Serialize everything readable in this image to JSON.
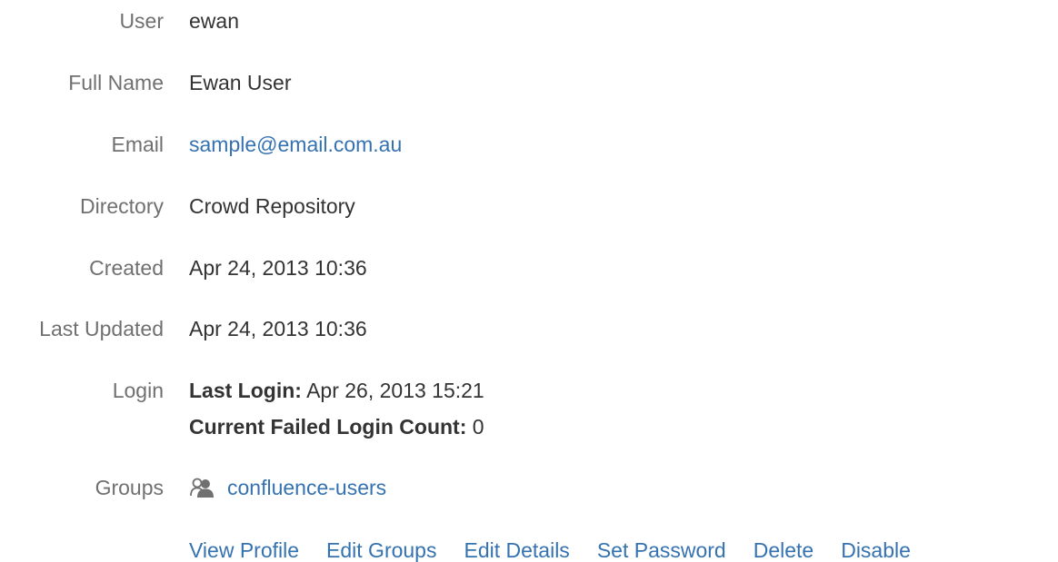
{
  "user": {
    "label": "User",
    "value": "ewan"
  },
  "full_name": {
    "label": "Full Name",
    "value": "Ewan User"
  },
  "email": {
    "label": "Email",
    "value": "sample@email.com.au"
  },
  "directory": {
    "label": "Directory",
    "value": "Crowd Repository"
  },
  "created": {
    "label": "Created",
    "value": "Apr 24, 2013 10:36"
  },
  "last_updated": {
    "label": "Last Updated",
    "value": "Apr 24, 2013 10:36"
  },
  "login": {
    "label": "Login",
    "last_login_label": "Last Login:",
    "last_login_value": "Apr 26, 2013 15:21",
    "failed_count_label": "Current Failed Login Count:",
    "failed_count_value": "0"
  },
  "groups": {
    "label": "Groups",
    "icon": "group-icon",
    "items": [
      "confluence-users"
    ]
  },
  "actions": {
    "view_profile": "View Profile",
    "edit_groups": "Edit Groups",
    "edit_details": "Edit Details",
    "set_password": "Set Password",
    "delete": "Delete",
    "disable": "Disable"
  },
  "colors": {
    "link": "#3572b0",
    "label": "#707070",
    "text": "#333333"
  }
}
